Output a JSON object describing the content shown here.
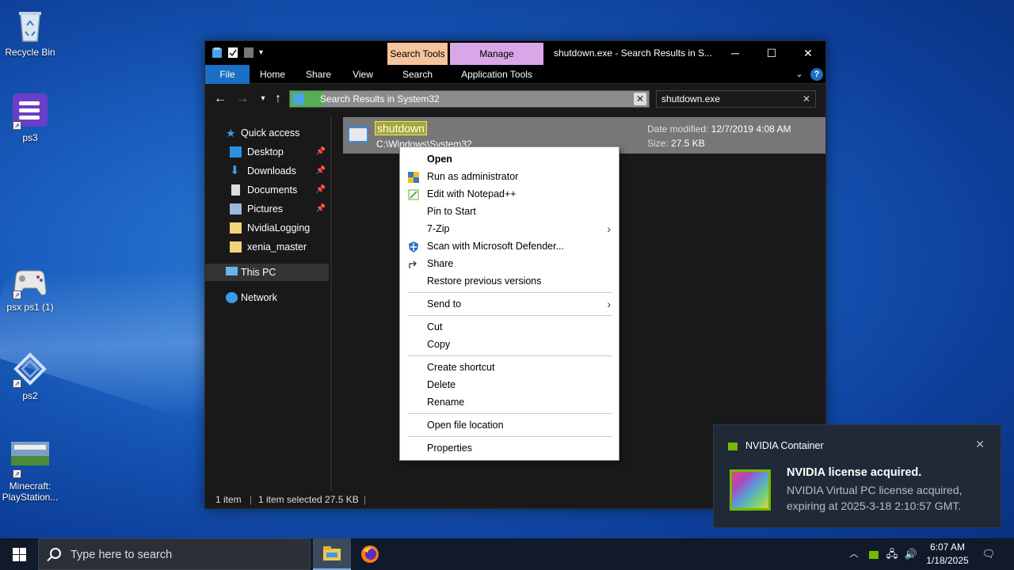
{
  "desktop": {
    "icons": [
      {
        "label": "Recycle Bin"
      },
      {
        "label": "ps3"
      },
      {
        "label": "psx ps1 (1)"
      },
      {
        "label": "ps2"
      },
      {
        "label": "Minecraft: PlayStation..."
      }
    ]
  },
  "explorer": {
    "title": "shutdown.exe - Search Results in S...",
    "context_tabs": {
      "search_tools": "Search Tools",
      "manage": "Manage"
    },
    "ribbon_tabs": [
      "File",
      "Home",
      "Share",
      "View",
      "Search",
      "Application Tools"
    ],
    "window_controls": {
      "minimize": "─",
      "maximize": "☐",
      "close": "✕"
    },
    "address": "Search Results in System32",
    "search_value": "shutdown.exe",
    "nav": {
      "quick_access": "Quick access",
      "items": [
        "Desktop",
        "Downloads",
        "Documents",
        "Pictures",
        "NvidiaLogging",
        "xenia_master"
      ],
      "this_pc": "This PC",
      "network": "Network"
    },
    "file": {
      "name": "shutdown",
      "path": "C:\\Windows\\System32",
      "date_label": "Date modified:",
      "date_value": "12/7/2019 4:08 AM",
      "size_label": "Size:",
      "size_value": "27.5 KB"
    },
    "status": {
      "count": "1 item",
      "selected": "1 item selected  27.5 KB"
    }
  },
  "context_menu": {
    "items": [
      {
        "label": "Open"
      },
      {
        "label": "Run as administrator"
      },
      {
        "label": "Edit with Notepad++"
      },
      {
        "label": "Pin to Start"
      },
      {
        "label": "7-Zip"
      },
      {
        "label": "Scan with Microsoft Defender..."
      },
      {
        "label": "Share"
      },
      {
        "label": "Restore previous versions"
      },
      {
        "label": "Send to"
      },
      {
        "label": "Cut"
      },
      {
        "label": "Copy"
      },
      {
        "label": "Create shortcut"
      },
      {
        "label": "Delete"
      },
      {
        "label": "Rename"
      },
      {
        "label": "Open file location"
      },
      {
        "label": "Properties"
      }
    ]
  },
  "toast": {
    "app": "NVIDIA Container",
    "title": "NVIDIA license acquired.",
    "body": "NVIDIA Virtual PC license acquired, expiring at 2025-3-18 2:10:57 GMT.",
    "accent": "#76b900"
  },
  "taskbar": {
    "search_placeholder": "Type here to search",
    "time": "6:07 AM",
    "date": "1/18/2025"
  }
}
